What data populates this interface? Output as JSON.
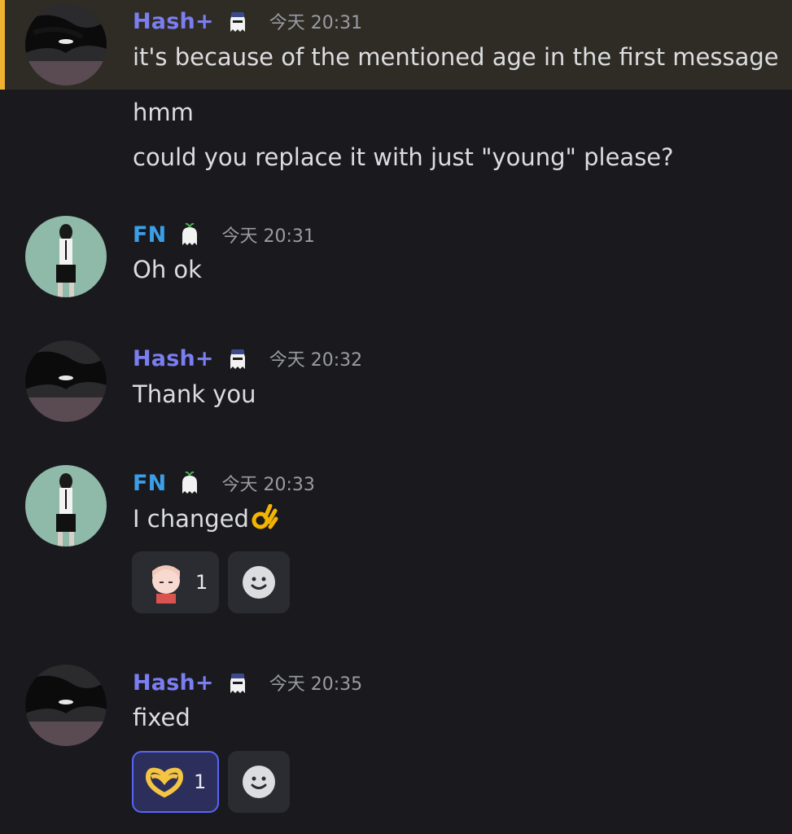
{
  "messages": [
    {
      "author": "Hash+",
      "author_tag_icon": "police-ghost-icon",
      "timestamp": "今天 20:31",
      "lines": [
        "it's because of the mentioned age in the first message",
        "hmm",
        "could you replace it with just \"young\" please?"
      ],
      "highlighted": true,
      "highlight_color": "#f0b232"
    },
    {
      "author": "FN",
      "author_tag_icon": "ghost-sprout-icon",
      "timestamp": "今天 20:31",
      "lines": [
        "Oh ok"
      ]
    },
    {
      "author": "Hash+",
      "author_tag_icon": "police-ghost-icon",
      "timestamp": "今天 20:32",
      "lines": [
        "Thank you"
      ]
    },
    {
      "author": "FN",
      "author_tag_icon": "ghost-sprout-icon",
      "timestamp": "今天 20:33",
      "lines": [
        "I changed"
      ],
      "inline_emoji": "ok-hand-icon",
      "reactions": [
        {
          "emoji": "anime-girl-sticker-icon",
          "count": "1",
          "active": false
        }
      ]
    },
    {
      "author": "Hash+",
      "author_tag_icon": "police-ghost-icon",
      "timestamp": "今天 20:35",
      "lines": [
        "fixed"
      ],
      "reactions": [
        {
          "emoji": "heart-hands-icon",
          "count": "1",
          "active": true
        }
      ]
    }
  ],
  "add_reaction_icon": "smiley-add-icon",
  "colors": {
    "background": "#1a1a1e",
    "hash_username": "#7b7ef0",
    "fn_username": "#3b9fe8",
    "active_reaction_border": "#5865f2"
  }
}
